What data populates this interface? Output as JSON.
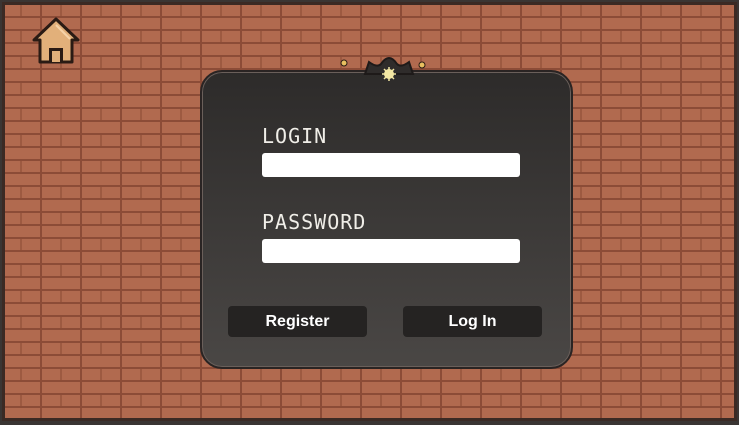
{
  "login": {
    "label": "LOGIN",
    "value": "",
    "placeholder": ""
  },
  "password": {
    "label": "PASSWORD",
    "value": "",
    "placeholder": ""
  },
  "buttons": {
    "register": "Register",
    "login": "Log In"
  },
  "icons": {
    "home": "home-icon",
    "ornament": "panel-ornament-icon"
  },
  "colors": {
    "brick": "#b16a4f",
    "mortar": "#8c4c37",
    "panel_dark": "#2d2b2a",
    "panel_light": "#4a4745",
    "button": "#252322",
    "text": "#f0eee8",
    "home_icon": "#e2b07a"
  }
}
